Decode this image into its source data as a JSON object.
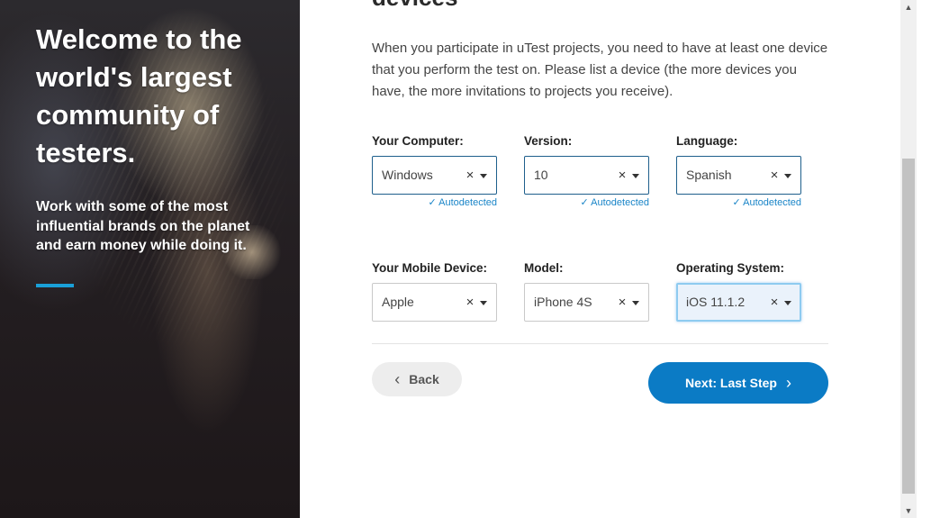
{
  "hero": {
    "headline": "Welcome to the world's largest community of testers.",
    "subtext": "Work with some of the most influential brands on the planet and earn money while doing it."
  },
  "main": {
    "section_title": "devices",
    "intro": "When you participate in uTest projects, you need to have at least one device that you perform the test on. Please list a device (the more devices you have, the more invitations to projects you receive).",
    "autodetected_label": "Autodetected",
    "computer": {
      "label": "Your Computer:",
      "value": "Windows"
    },
    "version": {
      "label": "Version:",
      "value": "10"
    },
    "language": {
      "label": "Language:",
      "value": "Spanish"
    },
    "mobile": {
      "label": "Your Mobile Device:",
      "value": "Apple"
    },
    "model": {
      "label": "Model:",
      "value": "iPhone 4S"
    },
    "os": {
      "label": "Operating System:",
      "value": "iOS 11.1.2"
    },
    "back_label": "Back",
    "next_label": "Next: Last Step"
  },
  "icons": {
    "clear": "×",
    "check": "✓",
    "chevron_left": "‹",
    "chevron_right": "›",
    "scroll_up": "▲",
    "scroll_down": "▼"
  },
  "colors": {
    "primary": "#0b7bc5",
    "accent": "#1aa0d8",
    "autodetected": "#1a85c8"
  }
}
